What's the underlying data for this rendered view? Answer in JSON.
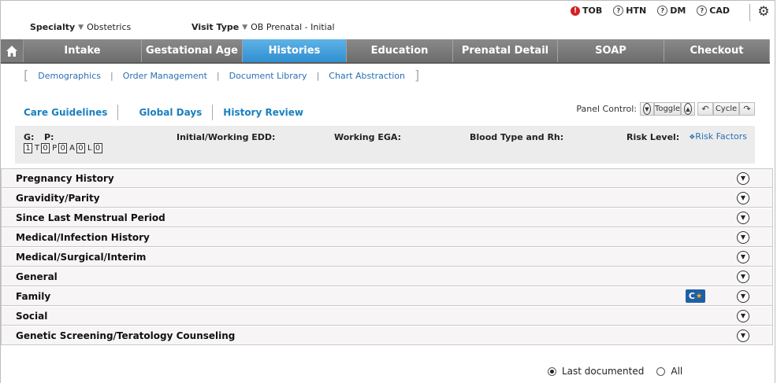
{
  "alerts": [
    {
      "label": "TOB",
      "icon": "alert-icon"
    },
    {
      "label": "HTN",
      "icon": "help-icon"
    },
    {
      "label": "DM",
      "icon": "help-icon"
    },
    {
      "label": "CAD",
      "icon": "help-icon"
    }
  ],
  "header": {
    "specialty_label": "Specialty",
    "specialty_value": "Obstetrics",
    "visit_type_label": "Visit Type",
    "visit_type_value": "OB Prenatal - Initial"
  },
  "nav": {
    "tabs": [
      {
        "label": "Intake"
      },
      {
        "label": "Gestational Age"
      },
      {
        "label": "Histories",
        "active": true
      },
      {
        "label": "Education"
      },
      {
        "label": "Prenatal Detail"
      },
      {
        "label": "SOAP"
      },
      {
        "label": "Checkout"
      }
    ]
  },
  "subnav": {
    "items": [
      "Demographics",
      "Order Management",
      "Document Library",
      "Chart Abstraction"
    ]
  },
  "care": {
    "links": [
      "Care Guidelines",
      "Global Days",
      "History Review"
    ],
    "panel_control_label": "Panel Control:",
    "toggle_label": "Toggle",
    "cycle_label": "Cycle"
  },
  "summary": {
    "g_label": "G:",
    "p_label": "P:",
    "g_value": "1",
    "p_letters": [
      "T",
      "P",
      "A",
      "L"
    ],
    "p_values": [
      "0",
      "0",
      "0",
      "0"
    ],
    "edd_label": "Initial/Working EDD:",
    "ega_label": "Working EGA:",
    "blood_label": "Blood Type and Rh:",
    "risk_label": "Risk Level:",
    "risk_factors_link": "Risk Factors"
  },
  "sections": [
    "Pregnancy History",
    "Gravidity/Parity",
    "Since Last Menstrual Period",
    "Medical/Infection History",
    "Medical/Surgical/Interim",
    "General",
    "Family",
    "Social",
    "Genetic Screening/Teratology Counseling"
  ],
  "footer": {
    "last_documented_label": "Last documented",
    "all_label": "All",
    "selected": "last_documented"
  }
}
